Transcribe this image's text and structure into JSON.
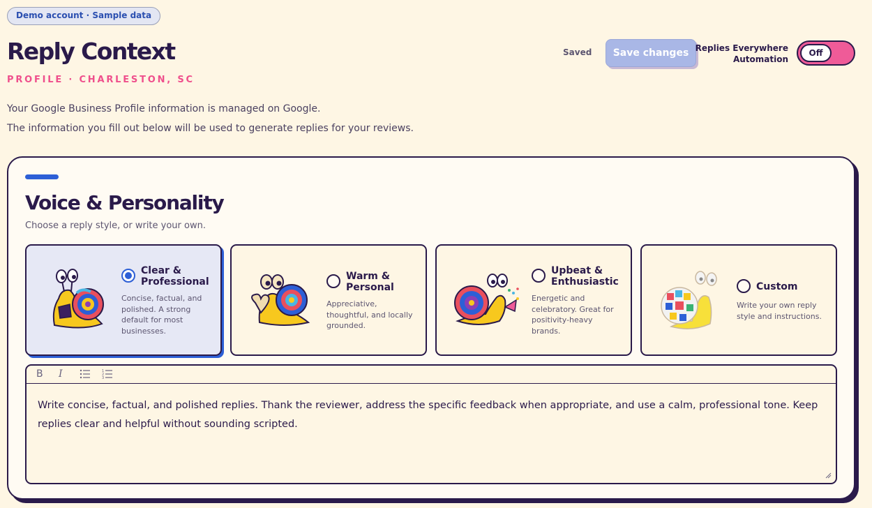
{
  "badge": "Demo account · Sample data",
  "header": {
    "title": "Reply Context",
    "subtitle": "PROFILE · CHARLESTON, SC",
    "info_line_1": "Your Google Business Profile information is managed on Google.",
    "info_line_2": "The information you fill out below will be used to generate replies for your reviews."
  },
  "actions": {
    "saved_label": "Saved",
    "save_button": "Save changes",
    "automation_label_line1": "Replies Everywhere",
    "automation_label_line2": "Automation",
    "toggle_state": "Off"
  },
  "voice": {
    "title": "Voice & Personality",
    "subtitle": "Choose a reply style, or write your own.",
    "styles": [
      {
        "name": "Clear & Professional",
        "description": "Concise, factual, and polished. A strong default for most businesses.",
        "selected": true
      },
      {
        "name": "Warm & Personal",
        "description": "Appreciative, thoughtful, and locally grounded.",
        "selected": false
      },
      {
        "name": "Upbeat & Enthusiastic",
        "description": "Energetic and celebratory. Great for positivity-heavy brands.",
        "selected": false
      },
      {
        "name": "Custom",
        "description": "Write your own reply style and instructions.",
        "selected": false
      }
    ],
    "editor": {
      "toolbar": [
        "bold-icon",
        "italic-icon",
        "bullet-list-icon",
        "numbered-list-icon"
      ],
      "text": "Write concise, factual, and polished replies. Thank the reviewer, address the specific feedback when appropriate, and use a calm, professional tone. Keep replies clear and helpful without sounding scripted."
    }
  },
  "colors": {
    "background": "#fef6e4",
    "ink": "#2a1a4a",
    "accent_pink": "#ef4f8c",
    "accent_blue": "#2d5fd6",
    "save_button_disabled": "#a9b7e6"
  }
}
